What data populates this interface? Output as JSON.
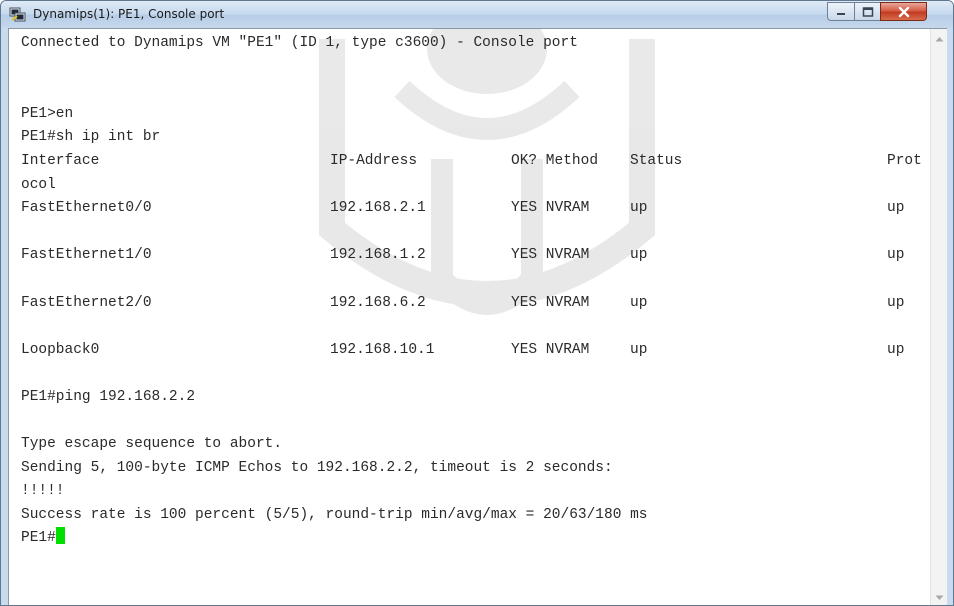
{
  "window": {
    "title": "Dynamips(1): PE1, Console port",
    "icon": "putty-terminal-icon"
  },
  "controls": {
    "minimize": "minimize-icon",
    "maximize": "maximize-icon",
    "close": "close-icon"
  },
  "console": {
    "connect_line": "Connected to Dynamips VM \"PE1\" (ID 1, type c3600) - Console port",
    "cmd_en": "PE1>en",
    "cmd_show": "PE1#sh ip int br",
    "header": {
      "interface": "Interface",
      "ip": "IP-Address",
      "ok_method": "OK? Method",
      "status": "Status",
      "prot": "Prot"
    },
    "header_wrap": "ocol",
    "interfaces": [
      {
        "name": "FastEthernet0/0",
        "ip": "192.168.2.1",
        "ok": "YES NVRAM",
        "status": "up",
        "protocol": "up"
      },
      {
        "name": "FastEthernet1/0",
        "ip": "192.168.1.2",
        "ok": "YES NVRAM",
        "status": "up",
        "protocol": "up"
      },
      {
        "name": "FastEthernet2/0",
        "ip": "192.168.6.2",
        "ok": "YES NVRAM",
        "status": "up",
        "protocol": "up"
      },
      {
        "name": "Loopback0",
        "ip": "192.168.10.1",
        "ok": "YES NVRAM",
        "status": "up",
        "protocol": "up"
      }
    ],
    "cmd_ping": "PE1#ping 192.168.2.2",
    "escape_line": "Type escape sequence to abort.",
    "sending_line": "Sending 5, 100-byte ICMP Echos to 192.168.2.2, timeout is 2 seconds:",
    "ping_marks": "!!!!!",
    "success_line": "Success rate is 100 percent (5/5), round-trip min/avg/max = 20/63/180 ms",
    "prompt": "PE1#"
  },
  "colors": {
    "cursor": "#00e000",
    "close_button": "#c9462c",
    "titlebar": "#c6d9ee"
  }
}
